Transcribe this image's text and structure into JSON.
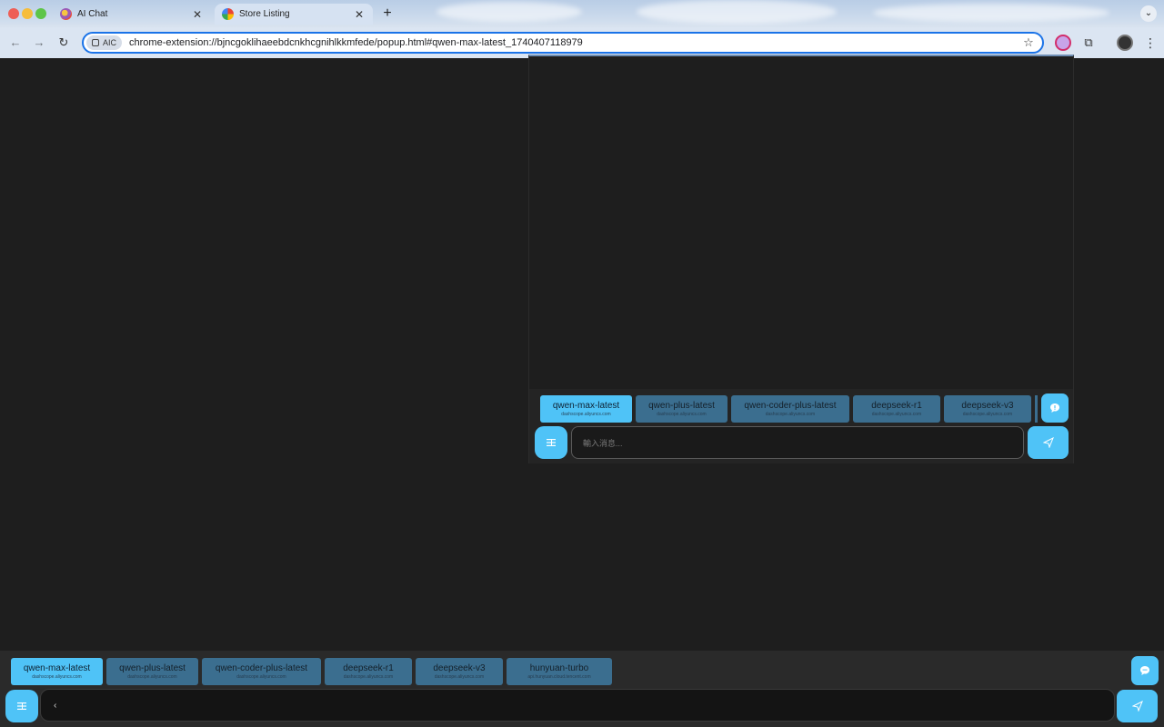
{
  "browser": {
    "tabs": [
      {
        "title": "AI Chat",
        "active": false
      },
      {
        "title": "Store Listing",
        "active": true
      }
    ],
    "new_tab_label": "+",
    "tab_menu_label": "⌄",
    "omnibox": {
      "chip_label": "AIC",
      "url": "chrome-extension://bjncgoklihaeebdcnkhcgnihlkkmfede/popup.html#qwen-max-latest_1740407118979"
    }
  },
  "popup": {
    "models": [
      {
        "name": "qwen-max-latest",
        "host": "dashscope.aliyuncs.com",
        "selected": true
      },
      {
        "name": "qwen-plus-latest",
        "host": "dashscope.aliyuncs.com",
        "selected": false
      },
      {
        "name": "qwen-coder-plus-latest",
        "host": "dashscope.aliyuncs.com",
        "selected": false
      },
      {
        "name": "deepseek-r1",
        "host": "dashscope.aliyuncs.com",
        "selected": false
      },
      {
        "name": "deepseek-v3",
        "host": "dashscope.aliyuncs.com",
        "selected": false
      }
    ],
    "input_placeholder": "輸入消息..."
  },
  "page_bar": {
    "models": [
      {
        "name": "qwen-max-latest",
        "host": "dashscope.aliyuncs.com",
        "selected": true
      },
      {
        "name": "qwen-plus-latest",
        "host": "dashscope.aliyuncs.com",
        "selected": false
      },
      {
        "name": "qwen-coder-plus-latest",
        "host": "dashscope.aliyuncs.com",
        "selected": false
      },
      {
        "name": "deepseek-r1",
        "host": "dashscope.aliyuncs.com",
        "selected": false
      },
      {
        "name": "deepseek-v3",
        "host": "dashscope.aliyuncs.com",
        "selected": false
      },
      {
        "name": "hunyuan-turbo",
        "host": "api.hunyuan.cloud.tencent.com",
        "selected": false
      }
    ],
    "input_value": "‹"
  },
  "colors": {
    "accent": "#4fc3f7",
    "model_chip": "#3b6e8f",
    "background": "#1e1e1e"
  }
}
